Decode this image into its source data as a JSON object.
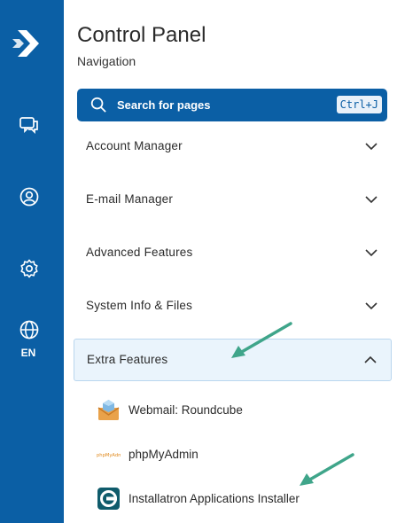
{
  "sidebar": {
    "icons": [
      "logo-icon",
      "chat-icon",
      "user-icon",
      "gear-icon",
      "globe-icon"
    ],
    "language": "EN",
    "accent_color": "#0b5fa5"
  },
  "header": {
    "title": "Control Panel",
    "subtitle": "Navigation"
  },
  "search": {
    "placeholder": "Search for pages",
    "shortcut": "Ctrl+J"
  },
  "menu": {
    "items": [
      {
        "label": "Account Manager",
        "expanded": false
      },
      {
        "label": "E-mail Manager",
        "expanded": false
      },
      {
        "label": "Advanced Features",
        "expanded": false
      },
      {
        "label": "System Info & Files",
        "expanded": false
      },
      {
        "label": "Extra Features",
        "expanded": true
      }
    ],
    "sub_items": [
      {
        "label": "Webmail: Roundcube",
        "icon": "roundcube-icon"
      },
      {
        "label": "phpMyAdmin",
        "icon": "phpmyadmin-icon",
        "icon_text": "phpMyAdmin"
      },
      {
        "label": "Installatron Applications Installer",
        "icon": "installatron-icon"
      }
    ]
  },
  "annotations": {
    "arrow_color": "#3fa58a"
  }
}
